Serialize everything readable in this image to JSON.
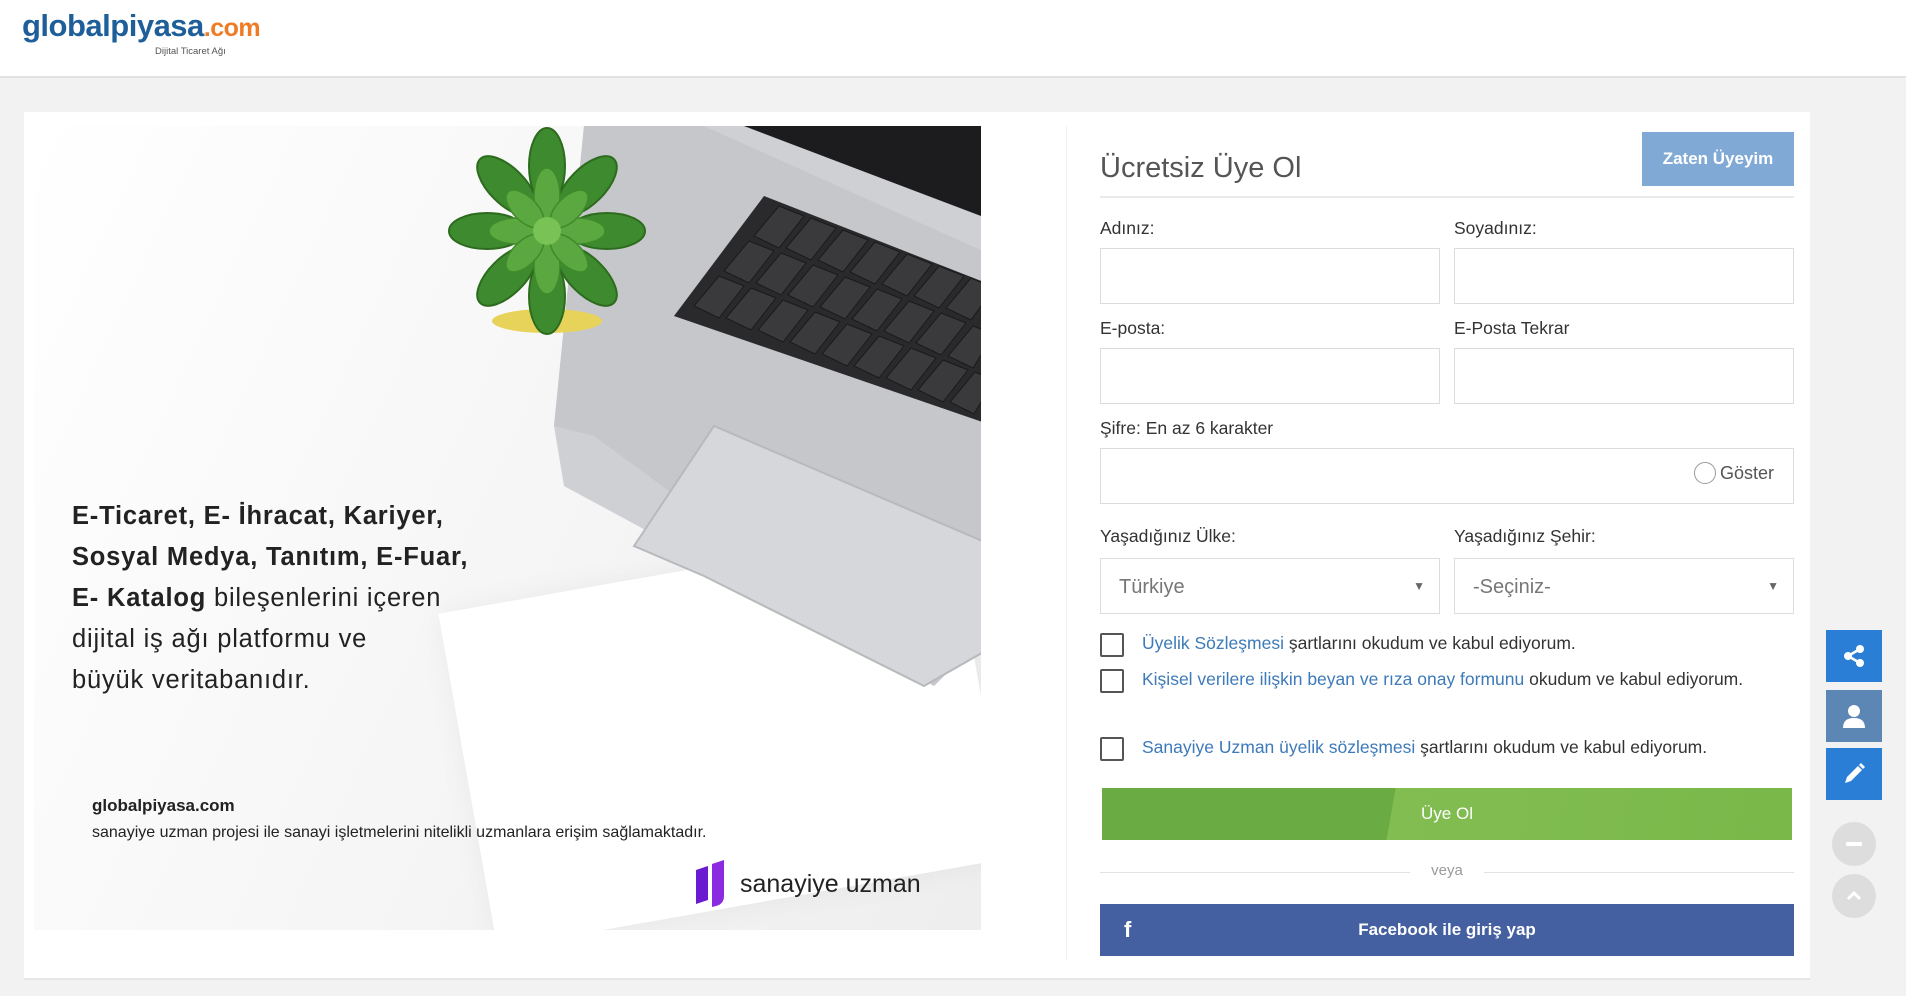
{
  "header": {
    "logo_main": "globalpiyasa",
    "logo_domain": ".com",
    "logo_sub": "Dijital Ticaret Ağı"
  },
  "promo": {
    "line1": "E-Ticaret, E- İhracat, Kariyer,",
    "line2": "Sosyal Medya, Tanıtım, E-Fuar,",
    "line3_bold": "E- Katalog",
    "line3_rest": " bileşenlerini içeren",
    "line4": "dijital iş ağı platformu ve",
    "line5": "büyük veritabanıdır.",
    "footer_title": "globalpiyasa.com",
    "footer_text": "sanayiye uzman projesi ile sanayi işletmelerini nitelikli uzmanlara erişim sağlamaktadır.",
    "brand": "sanayiye uzman"
  },
  "form": {
    "title": "Ücretsiz Üye Ol",
    "member_button": "Zaten Üyeyim",
    "first_name_label": "Adınız:",
    "last_name_label": "Soyadınız:",
    "email_label": "E-posta:",
    "email_repeat_label": "E-Posta Tekrar",
    "password_label": "Şifre: En az 6 karakter",
    "show_password": "Göster",
    "country_label": "Yaşadığınız Ülke:",
    "city_label": "Yaşadığınız Şehir:",
    "country_value": "Türkiye",
    "city_value": "-Seçiniz-",
    "agreement1_link": "Üyelik Sözleşmesi",
    "agreement1_rest": " şartlarını okudum ve kabul ediyorum.",
    "agreement2_link": "Kişisel verilere ilişkin beyan ve rıza onay formunu",
    "agreement2_rest": " okudum ve kabul ediyorum.",
    "agreement3_link": "Sanayiye Uzman üyelik sözleşmesi",
    "agreement3_rest": " şartlarını okudum ve kabul ediyorum.",
    "signup_button": "Üye Ol",
    "or_text": "veya",
    "facebook_button": "Facebook ile giriş yap",
    "facebook_icon": "f"
  },
  "floating": {
    "icons": [
      "share-icon",
      "user-icon",
      "pencil-icon",
      "minus-icon",
      "chevron-up-icon"
    ]
  },
  "colors": {
    "brand_blue": "#1f5f99",
    "brand_orange": "#f07b25",
    "signup_green": "#6aab43",
    "facebook_blue": "#4560a1",
    "member_button": "#80a9d6",
    "link_blue": "#3d7ab9"
  }
}
